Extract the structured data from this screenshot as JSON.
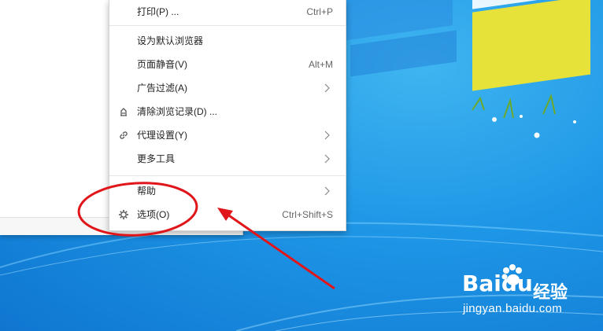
{
  "menu": {
    "items": [
      {
        "label": "打印(P) ...",
        "shortcut": "Ctrl+P"
      },
      {
        "label": "设为默认浏览器"
      },
      {
        "label": "页面静音(V)",
        "shortcut": "Alt+M"
      },
      {
        "label": "广告过滤(A)",
        "submenu": true
      },
      {
        "label": "清除浏览记录(D) ...",
        "icon": "eraser-icon"
      },
      {
        "label": "代理设置(Y)",
        "submenu": true,
        "icon": "link-icon"
      },
      {
        "label": "更多工具",
        "submenu": true
      },
      {
        "label": "帮助",
        "submenu": true
      },
      {
        "label": "选项(O)",
        "shortcut": "Ctrl+Shift+S",
        "icon": "gear-icon"
      }
    ]
  },
  "watermark": {
    "logo_text": "Baidu",
    "service": "经验",
    "url": "jingyan.baidu.com"
  },
  "colors": {
    "desktop_blue": "#1e96e6",
    "annotation_red": "#e0161b"
  }
}
